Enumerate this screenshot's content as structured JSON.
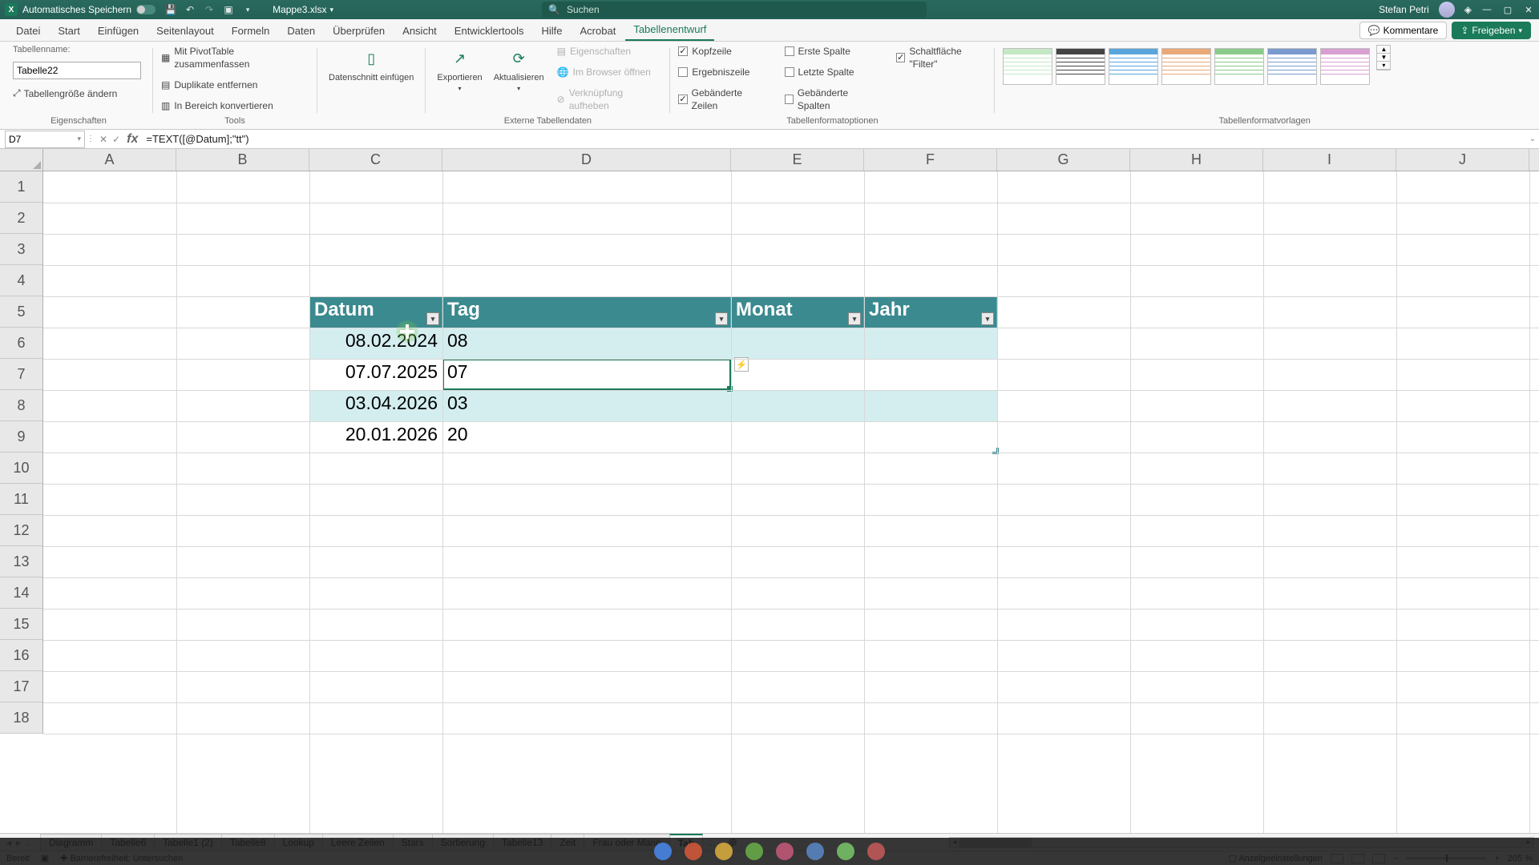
{
  "titlebar": {
    "autosave_label": "Automatisches Speichern",
    "doc_name": "Mappe3.xlsx",
    "search_placeholder": "Suchen",
    "user_name": "Stefan Petri"
  },
  "tabs": {
    "datei": "Datei",
    "start": "Start",
    "einfuegen": "Einfügen",
    "seitenlayout": "Seitenlayout",
    "formeln": "Formeln",
    "daten": "Daten",
    "ueberpruefen": "Überprüfen",
    "ansicht": "Ansicht",
    "entwicklertools": "Entwicklertools",
    "hilfe": "Hilfe",
    "acrobat": "Acrobat",
    "tabellenentwurf": "Tabellenentwurf",
    "kommentare": "Kommentare",
    "freigeben": "Freigeben"
  },
  "ribbon": {
    "tablename_label": "Tabellenname:",
    "tablename_value": "Tabelle22",
    "resize": "Tabellengröße ändern",
    "group_eigenschaften": "Eigenschaften",
    "pivot": "Mit PivotTable zusammenfassen",
    "dup": "Duplikate entfernen",
    "range": "In Bereich konvertieren",
    "group_tools": "Tools",
    "slicer": "Datenschnitt einfügen",
    "export": "Exportieren",
    "refresh": "Aktualisieren",
    "props": "Eigenschaften",
    "browser": "Im Browser öffnen",
    "unlink": "Verknüpfung aufheben",
    "group_extern": "Externe Tabellendaten",
    "kopfzeile": "Kopfzeile",
    "ergebnis": "Ergebniszeile",
    "gebaend_z": "Gebänderte Zeilen",
    "erste_sp": "Erste Spalte",
    "letzte_sp": "Letzte Spalte",
    "gebaend_sp": "Gebänderte Spalten",
    "filter": "Schaltfläche \"Filter\"",
    "group_options": "Tabellenformatoptionen",
    "group_styles": "Tabellenformatvorlagen"
  },
  "fx": {
    "namebox": "D7",
    "formula": "=TEXT([@Datum];\"tt\")"
  },
  "columns": [
    "A",
    "B",
    "C",
    "D",
    "E",
    "F",
    "G",
    "H",
    "I",
    "J"
  ],
  "rows": [
    "1",
    "2",
    "3",
    "4",
    "5",
    "6",
    "7",
    "8",
    "9",
    "10",
    "11",
    "12",
    "13",
    "14",
    "15",
    "16",
    "17",
    "18"
  ],
  "table": {
    "headers": {
      "datum": "Datum",
      "tag": "Tag",
      "monat": "Monat",
      "jahr": "Jahr"
    },
    "data": [
      {
        "datum": "08.02.2024",
        "tag": "08",
        "monat": "",
        "jahr": ""
      },
      {
        "datum": "07.07.2025",
        "tag": "07",
        "monat": "",
        "jahr": ""
      },
      {
        "datum": "03.04.2026",
        "tag": "03",
        "monat": "",
        "jahr": ""
      },
      {
        "datum": "20.01.2026",
        "tag": "20",
        "monat": "",
        "jahr": ""
      }
    ]
  },
  "sheets": {
    "list": [
      "Diagramm",
      "Tabelle6",
      "Tabelle1 (2)",
      "Tabelle8",
      "Lookup",
      "Leere Zeilen",
      "Stars",
      "Sortierung",
      "Tabelle13",
      "Zeit",
      "Frau oder Mann"
    ],
    "active_partial": "Tab",
    "more": "..."
  },
  "status": {
    "ready": "Bereit",
    "access": "Barrierefreiheit: Untersuchen",
    "display": "Anzeigeeinstellungen",
    "zoom": "205 %"
  },
  "style_colors": [
    "#c4e8c4",
    "#444444",
    "#5aa5dc",
    "#e8a878",
    "#8cca8c",
    "#7a9ad0",
    "#d8a0d0"
  ]
}
